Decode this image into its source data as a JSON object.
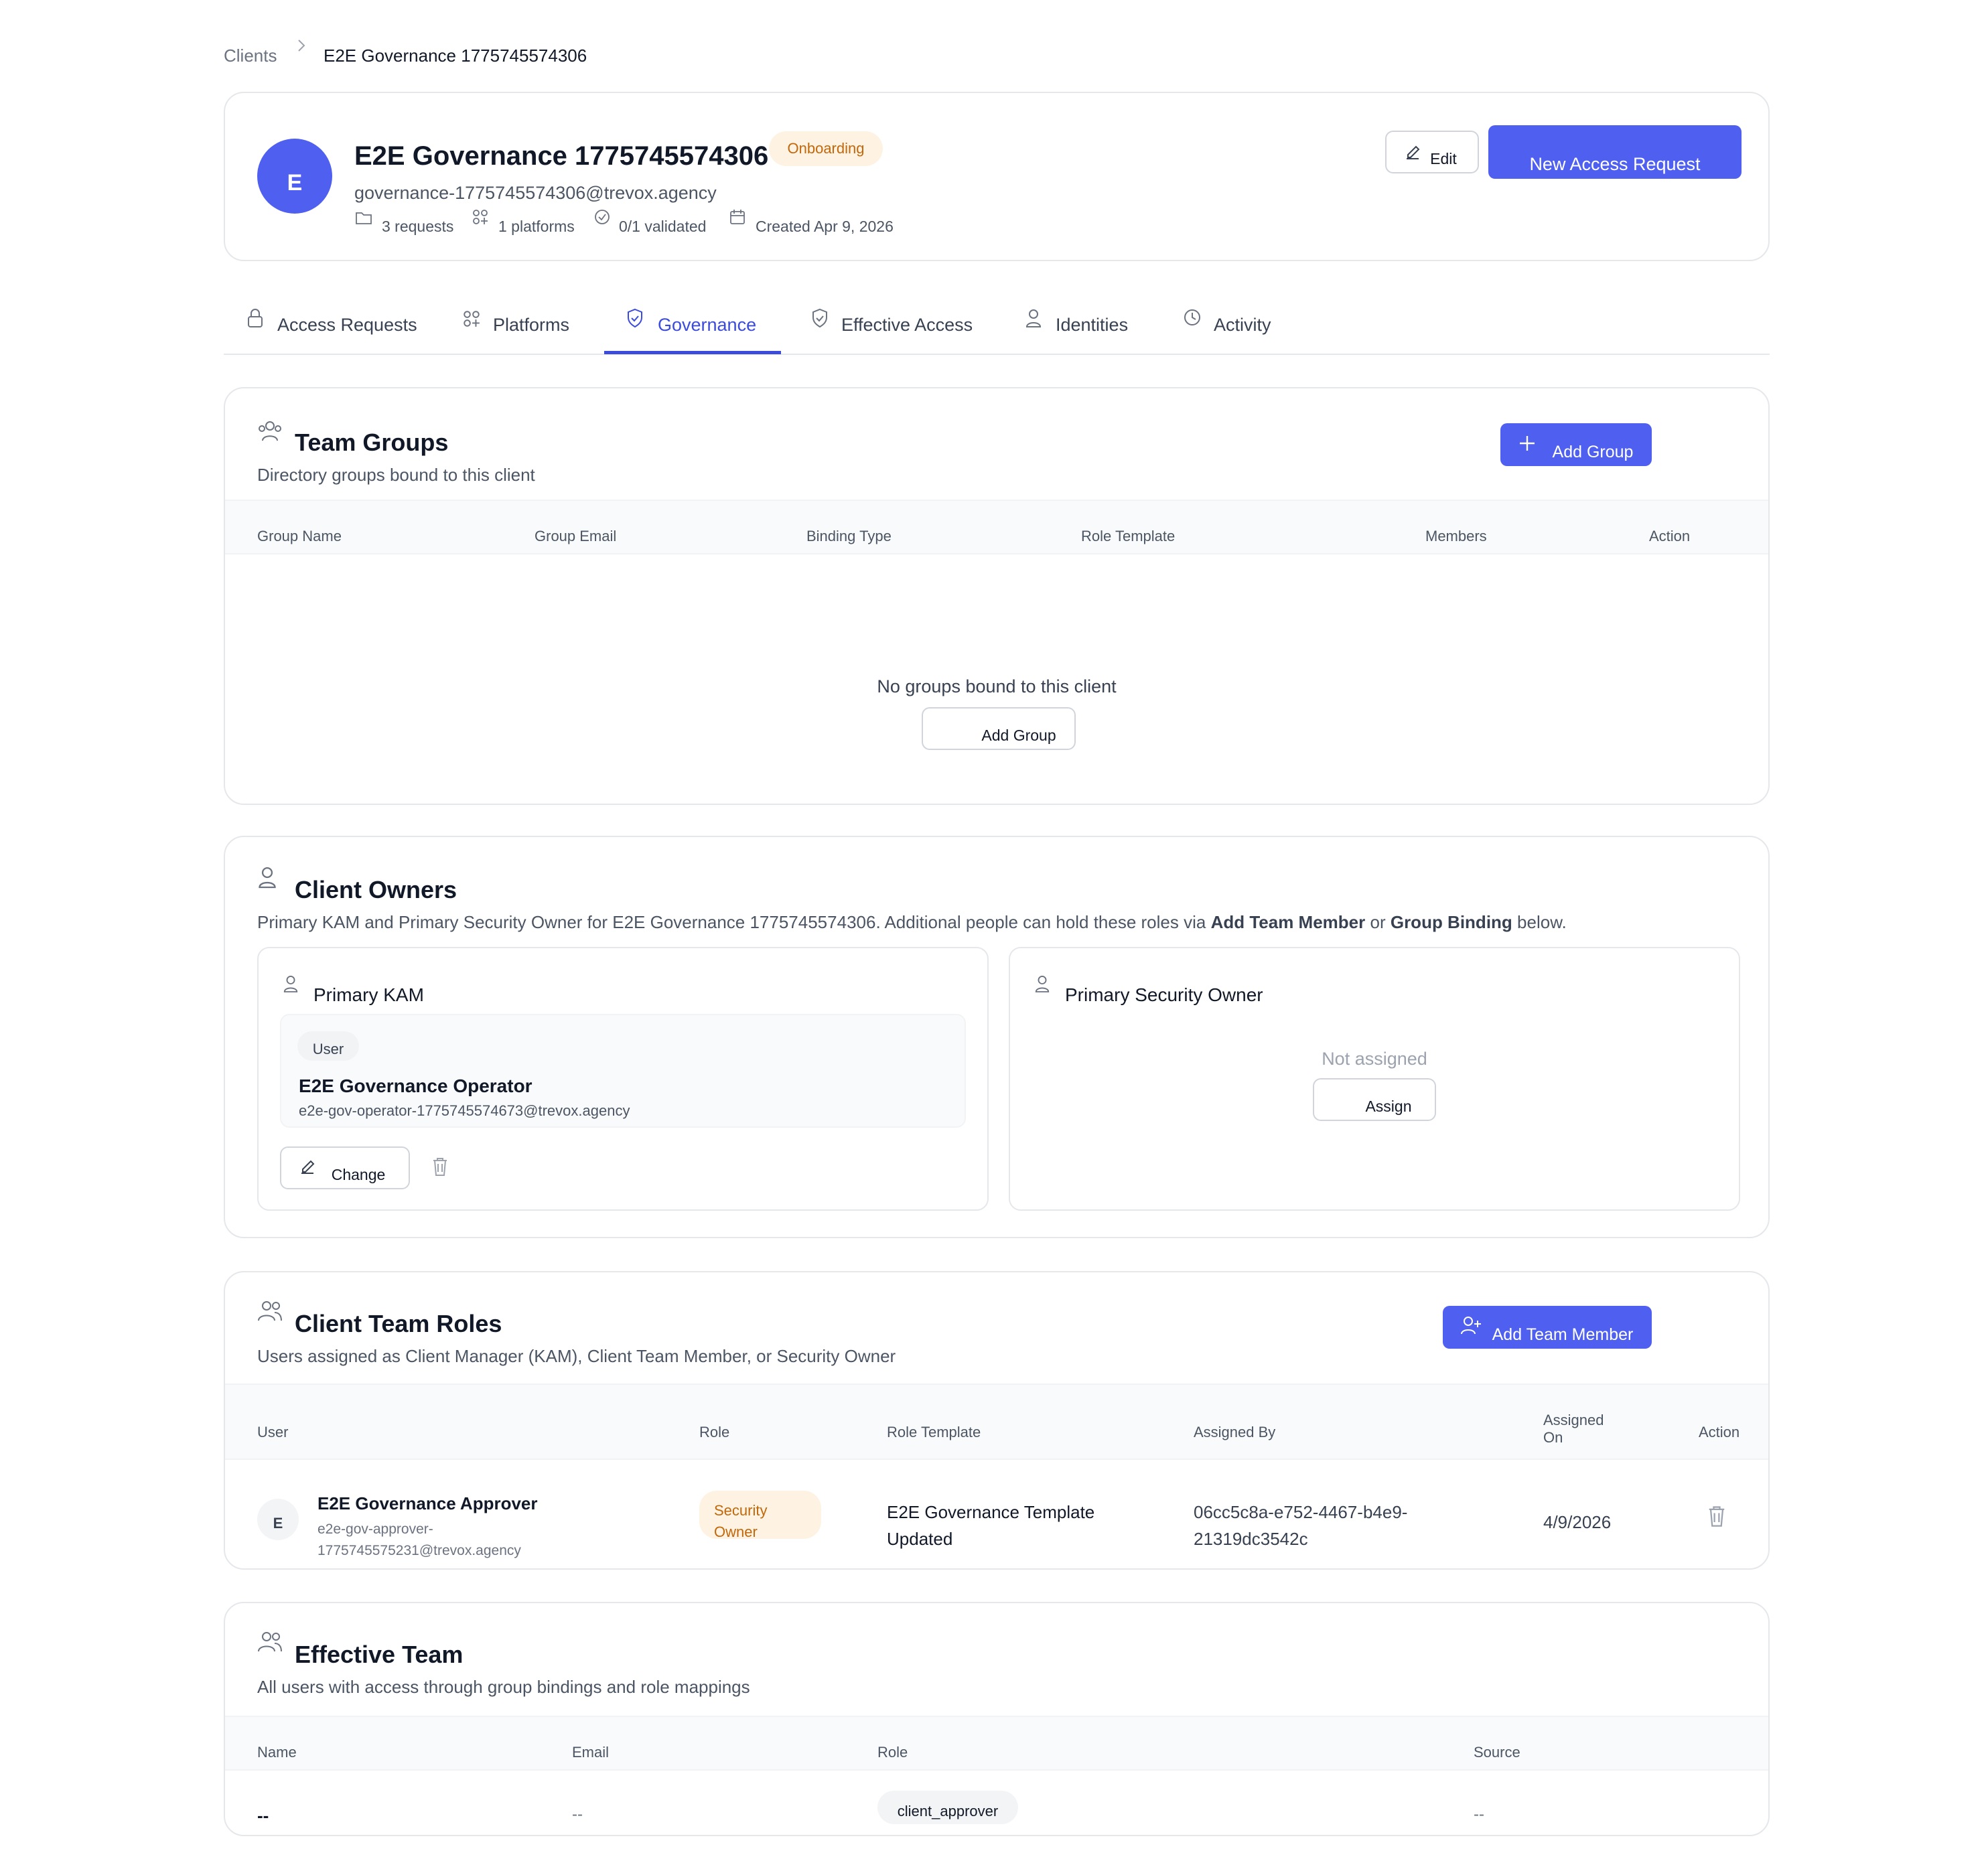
{
  "breadcrumb": {
    "parent": "Clients",
    "current": "E2E Governance 1775745574306"
  },
  "client": {
    "avatar_letter": "E",
    "name": "E2E Governance 1775745574306",
    "status": "Onboarding",
    "email": "governance-1775745574306@trevox.agency",
    "meta": {
      "requests": "3 requests",
      "platforms": "1 platforms",
      "validated": "0/1 validated",
      "created": "Created Apr 9, 2026"
    },
    "edit_label": "Edit",
    "new_request_label": "New Access Request"
  },
  "tabs": [
    {
      "label": "Access Requests"
    },
    {
      "label": "Platforms"
    },
    {
      "label": "Governance"
    },
    {
      "label": "Effective Access"
    },
    {
      "label": "Identities"
    },
    {
      "label": "Activity"
    }
  ],
  "team_groups": {
    "title": "Team Groups",
    "subtitle": "Directory groups bound to this client",
    "add_label": "Add Group",
    "columns": [
      "Group Name",
      "Group Email",
      "Binding Type",
      "Role Template",
      "Members",
      "Action"
    ],
    "empty_text": "No groups bound to this client",
    "empty_add_label": "Add Group"
  },
  "client_owners": {
    "title": "Client Owners",
    "subtitle_prefix": "Primary KAM and Primary Security Owner for E2E Governance 1775745574306. Additional people can hold these roles via ",
    "subtitle_link1": "Add Team Member",
    "subtitle_mid": " or ",
    "subtitle_link2": "Group Binding",
    "subtitle_suffix": " below.",
    "kam": {
      "title": "Primary KAM",
      "type_badge": "User",
      "name": "E2E Governance Operator",
      "email": "e2e-gov-operator-1775745574673@trevox.agency",
      "change_label": "Change"
    },
    "security": {
      "title": "Primary Security Owner",
      "empty_text": "Not assigned",
      "assign_label": "Assign"
    }
  },
  "team_roles": {
    "title": "Client Team Roles",
    "subtitle": "Users assigned as Client Manager (KAM), Client Team Member, or Security Owner",
    "add_label": "Add Team Member",
    "columns": {
      "user": "User",
      "role": "Role",
      "template": "Role Template",
      "assigned_by": "Assigned By",
      "assigned_on_1": "Assigned",
      "assigned_on_2": "On",
      "action": "Action"
    },
    "rows": [
      {
        "avatar": "E",
        "name": "E2E Governance Approver",
        "email_1": "e2e-gov-approver-",
        "email_2": "1775745575231@trevox.agency",
        "role_1": "Security",
        "role_2": "Owner",
        "template_1": "E2E Governance Template",
        "template_2": "Updated",
        "assigned_by_1": "06cc5c8a-e752-4467-b4e9-",
        "assigned_by_2": "21319dc3542c",
        "assigned_on": "4/9/2026"
      }
    ]
  },
  "effective_team": {
    "title": "Effective Team",
    "subtitle": "All users with access through group bindings and role mappings",
    "columns": [
      "Name",
      "Email",
      "Role",
      "Source"
    ],
    "rows": [
      {
        "name": "--",
        "email": "--",
        "role": "client_approver",
        "source": "--"
      }
    ]
  },
  "colors": {
    "primary": "#4f5ff0",
    "tab_active": "#3b4bdb",
    "onboarding_text": "#c2670a",
    "onboarding_bg": "#fef3e2"
  }
}
